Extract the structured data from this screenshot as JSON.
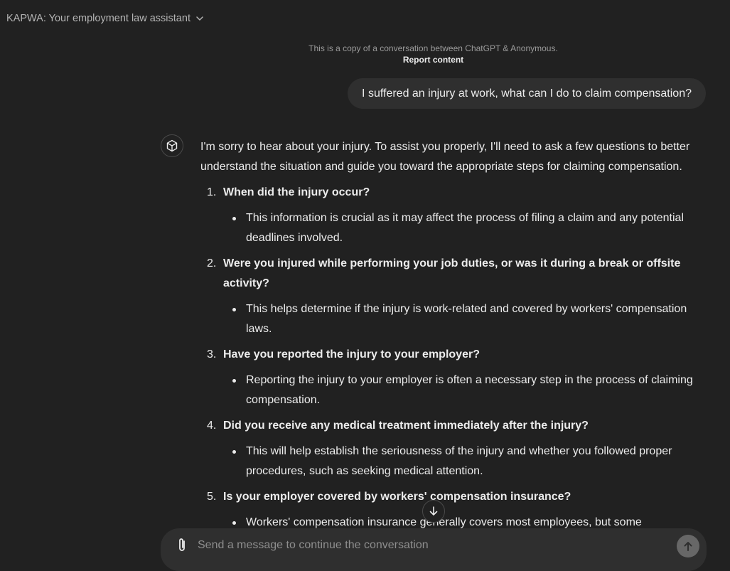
{
  "header": {
    "title": "KAPWA: Your employment law assistant",
    "chevron_icon": "chevron-down-icon"
  },
  "share": {
    "note": "This is a copy of a conversation between ChatGPT & Anonymous.",
    "report_label": "Report content"
  },
  "user_message": "I suffered an injury at work, what can I do to claim compensation?",
  "assistant": {
    "avatar_icon": "openai-logo-icon",
    "intro": "I'm sorry to hear about your injury. To assist you properly, I'll need to ask a few questions to better understand the situation and guide you toward the appropriate steps for claiming compensation.",
    "questions": [
      {
        "number": "1.",
        "title": "When did the injury occur?",
        "detail": "This information is crucial as it may affect the process of filing a claim and any potential deadlines involved."
      },
      {
        "number": "2.",
        "title": "Were you injured while performing your job duties, or was it during a break or offsite activity?",
        "detail": "This helps determine if the injury is work-related and covered by workers' compensation laws."
      },
      {
        "number": "3.",
        "title": "Have you reported the injury to your employer?",
        "detail": "Reporting the injury to your employer is often a necessary step in the process of claiming compensation."
      },
      {
        "number": "4.",
        "title": "Did you receive any medical treatment immediately after the injury?",
        "detail": "This will help establish the seriousness of the injury and whether you followed proper procedures, such as seeking medical attention."
      },
      {
        "number": "5.",
        "title": "Is your employer covered by workers' compensation insurance?",
        "detail": "Workers' compensation insurance generally covers most employees, but some exceptions"
      }
    ]
  },
  "composer": {
    "placeholder": "Send a message to continue the conversation",
    "attach_icon": "paperclip-icon",
    "send_icon": "arrow-up-icon"
  },
  "scroll_icon": "arrow-down-icon"
}
